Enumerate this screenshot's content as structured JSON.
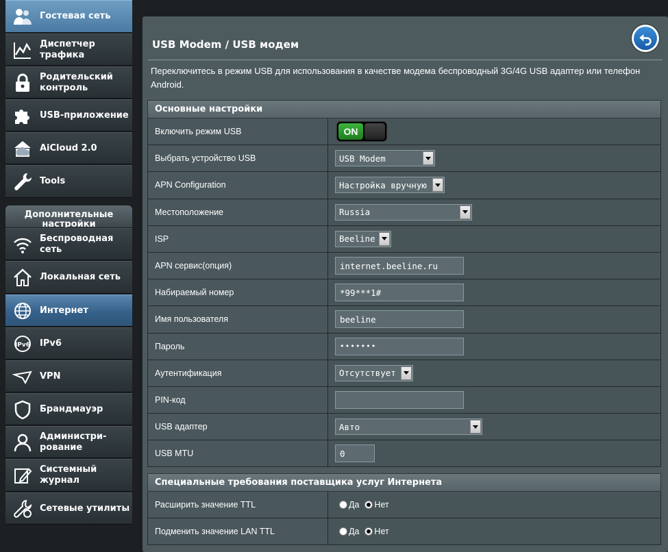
{
  "sidebar": {
    "top_items": [
      {
        "label": "Гостевая сеть",
        "icon": "guest-network-icon"
      },
      {
        "label": "Диспетчер трафика",
        "icon": "traffic-manager-icon"
      },
      {
        "label": "Родительский контроль",
        "icon": "lock-icon"
      },
      {
        "label": "USB-приложение",
        "icon": "puzzle-icon"
      },
      {
        "label": "AiCloud 2.0",
        "icon": "cloud-icon"
      },
      {
        "label": "Tools",
        "icon": "wrench-icon"
      }
    ],
    "advanced_header": "Дополнительные настройки",
    "advanced_items": [
      {
        "label": "Беспроводная сеть",
        "icon": "wifi-icon"
      },
      {
        "label": "Локальная сеть",
        "icon": "home-icon"
      },
      {
        "label": "Интернет",
        "icon": "globe-icon"
      },
      {
        "label": "IPv6",
        "icon": "ipv6-icon"
      },
      {
        "label": "VPN",
        "icon": "vpn-icon"
      },
      {
        "label": "Брандмауэр",
        "icon": "shield-icon"
      },
      {
        "label": "Администри-рование",
        "icon": "admin-user-icon"
      },
      {
        "label": "Системный журнал",
        "icon": "log-edit-icon"
      },
      {
        "label": "Сетевые утилиты",
        "icon": "network-tools-icon"
      }
    ]
  },
  "main": {
    "title": "USB Modem / USB модем",
    "description": "Переключитесь в режим USB для использования в качестве модема беспроводный 3G/4G USB адаптер или телефон Android.",
    "basic_section": {
      "header": "Основные настройки",
      "enable_usb_label": "Включить режим USB",
      "enable_usb_value": "ON",
      "select_device_label": "Выбрать устройство USB",
      "select_device_value": "USB Modem",
      "apn_config_label": "APN Configuration",
      "apn_config_value": "Настройка вручную",
      "location_label": "Местоположение",
      "location_value": "Russia",
      "isp_label": "ISP",
      "isp_value": "Beeline",
      "apn_service_label": "APN сервис(опция)",
      "apn_service_value": "internet.beeline.ru",
      "dial_number_label": "Набираемый номер",
      "dial_number_value": "*99***1#",
      "username_label": "Имя пользователя",
      "username_value": "beeline",
      "password_label": "Пароль",
      "password_value": "•••••••",
      "auth_label": "Аутентификация",
      "auth_value": "Отсутствует",
      "pin_label": "PIN-код",
      "pin_value": "",
      "usb_adapter_label": "USB адаптер",
      "usb_adapter_value": "Авто",
      "usb_mtu_label": "USB MTU",
      "usb_mtu_value": "0"
    },
    "isp_section": {
      "header": "Специальные требования поставщика услуг Интернета",
      "extend_ttl_label": "Расширить значение TTL",
      "spoof_ttl_label": "Подменить значение LAN TTL",
      "yes_label": "Да",
      "no_label": "Нет"
    }
  },
  "colors": {
    "accent_blue": "#4a7aa2",
    "toggle_green": "#2a9a2a",
    "panel": "#4d5b5f"
  }
}
